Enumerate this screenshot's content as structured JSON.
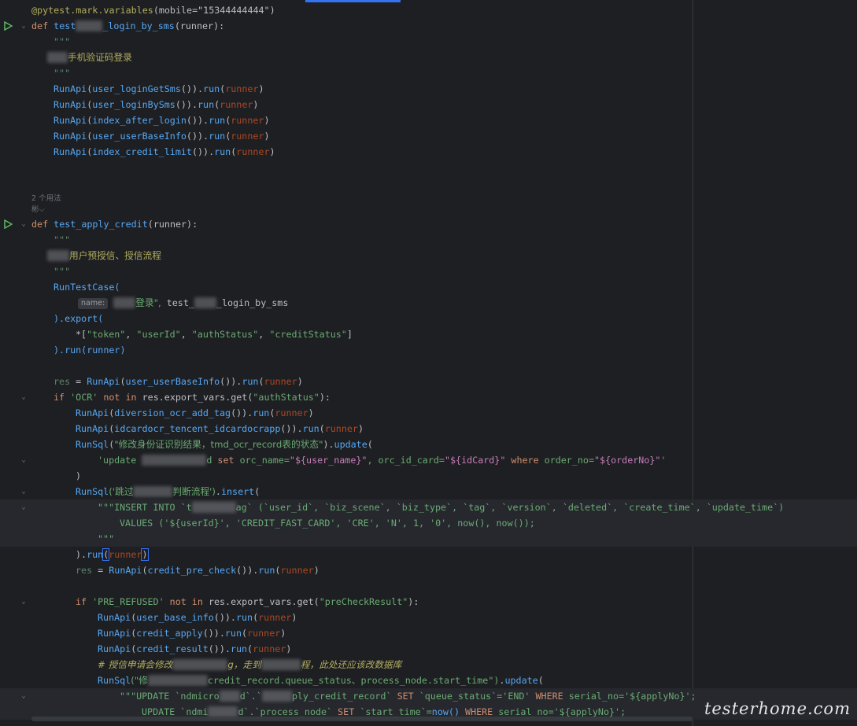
{
  "editor": {
    "decorator": "@pytest.mark.variables",
    "decorator_arg": "mobile=\"15344444444\"",
    "func1": {
      "def": "def",
      "name_prefix": "test",
      "name_suffix": "_login_by_sms",
      "params": "(runner):",
      "doc_open": "\"\"\"",
      "doc_text": "手机验证码登录",
      "doc_close": "\"\"\"",
      "calls": [
        {
          "fn": "RunApi",
          "arg": "user_loginGetSms",
          "run": "run",
          "runner": "runner"
        },
        {
          "fn": "RunApi",
          "arg": "user_loginBySms",
          "run": "run",
          "runner": "runner"
        },
        {
          "fn": "RunApi",
          "arg": "index_after_login",
          "run": "run",
          "runner": "runner"
        },
        {
          "fn": "RunApi",
          "arg": "user_userBaseInfo",
          "run": "run",
          "runner": "runner"
        },
        {
          "fn": "RunApi",
          "arg": "index_credit_limit",
          "run": "run",
          "runner": "runner"
        }
      ]
    },
    "hint_usages": "2 个用法",
    "hint_author": "彬⌵",
    "func2": {
      "def": "def",
      "name": "test_apply_credit",
      "params": "(runner):",
      "doc_open": "\"\"\"",
      "doc_text": "用户预授信、授信流程",
      "doc_close": "\"\"\"",
      "runtestcase": "RunTestCase(",
      "name_hint": "name:",
      "case_name_tail": "登录\",",
      "case_ref_prefix": "test_",
      "case_ref_suffix": "_login_by_sms",
      "export_open": ").export(",
      "export_star": "*[",
      "export_items": [
        "\"token\"",
        "\"userId\"",
        "\"authStatus\"",
        "\"creditStatus\""
      ],
      "export_close": "]",
      "run_close": ").run(runner)",
      "res_line": {
        "var": "res",
        "fn": "RunApi",
        "arg": "user_userBaseInfo",
        "runner": "runner"
      },
      "if_ocr": {
        "kw_if": "if",
        "str": "'OCR'",
        "kw_not_in": "not in",
        "obj": "res.export_vars.get",
        "key": "\"authStatus\""
      },
      "ocr_calls": [
        {
          "fn": "RunApi",
          "arg": "diversion_ocr_add_tag",
          "runner": "runner"
        },
        {
          "fn": "RunApi",
          "arg": "idcardocr_tencent_idcardocrapp",
          "runner": "runner"
        }
      ],
      "runsql1": {
        "fn": "RunSql",
        "label": "\"修改身份证识别结果，tmd_ocr_record表的状态\"",
        "method": "update",
        "sql_kw_update": "'update",
        "sql_tail_1": "d",
        "sql_kw_set": "set",
        "sql_field1": "orc_name=",
        "sql_val1": "\"${user_name}\"",
        "sql_field2": "orc_id_card=",
        "sql_val2": "\"${idCard}\"",
        "sql_kw_where": "where",
        "sql_field3": "order_no=",
        "sql_val3": "\"${orderNo}\"",
        "sql_end": "'"
      },
      "runsql2": {
        "fn": "RunSql",
        "label_head": "('跳过",
        "label_tail": "判断流程')",
        "method": "insert",
        "insert_kw": "\"\"\"INSERT INTO",
        "insert_table_head": "`t",
        "insert_table_tail": "ag`",
        "insert_cols": "(`user_id`, `biz_scene`, `biz_type`, `tag`, `version`, `deleted`, `create_time`, `update_time`)",
        "values_kw": "VALUES",
        "values_body": "('${userId}', 'CREDIT_FAST_CARD', 'CRE', 'N', 1, '0', now(), now());",
        "close_doc": "\"\"\"",
        "run_line": ").run(runner)"
      },
      "res_line2": {
        "var": "res",
        "fn": "RunApi",
        "arg": "credit_pre_check",
        "runner": "runner"
      },
      "if_pre": {
        "kw_if": "if",
        "str": "'PRE_REFUSED'",
        "kw_not_in": "not in",
        "obj": "res.export_vars.get",
        "key": "\"preCheckResult\""
      },
      "pre_calls": [
        {
          "fn": "RunApi",
          "arg": "user_base_info",
          "runner": "runner"
        },
        {
          "fn": "RunApi",
          "arg": "credit_apply",
          "runner": "runner"
        },
        {
          "fn": "RunApi",
          "arg": "credit_result",
          "runner": "runner"
        }
      ],
      "comment": {
        "head": "# 授信申请会修改",
        "mid": "g，走到",
        "tail": "程，此处还应该改数据库"
      },
      "runsql3": {
        "fn": "RunSql",
        "label_head": "(\"修",
        "label_tail": "credit_record.queue_status、process_node.start_time\")",
        "method": "update",
        "line1_kw": "\"\"\"UPDATE",
        "line1_t1": "`ndmicro",
        "line1_t1b": "d`.`",
        "line1_t2": "ply_credit_record`",
        "line1_set": "SET",
        "line1_field": "`queue_status`='END'",
        "line1_where": "WHERE",
        "line1_cond": "serial_no='${applyNo}';",
        "line2_kw": "UPDATE",
        "line2_t1": "`ndmi",
        "line2_t1b": "d`.`process_node`",
        "line2_set": "SET",
        "line2_field": "`start_time`=",
        "line2_now": "now()",
        "line2_where": "WHERE",
        "line2_cond": "serial_no='${applyNo}';"
      }
    },
    "watermark": "testerhome.com"
  }
}
